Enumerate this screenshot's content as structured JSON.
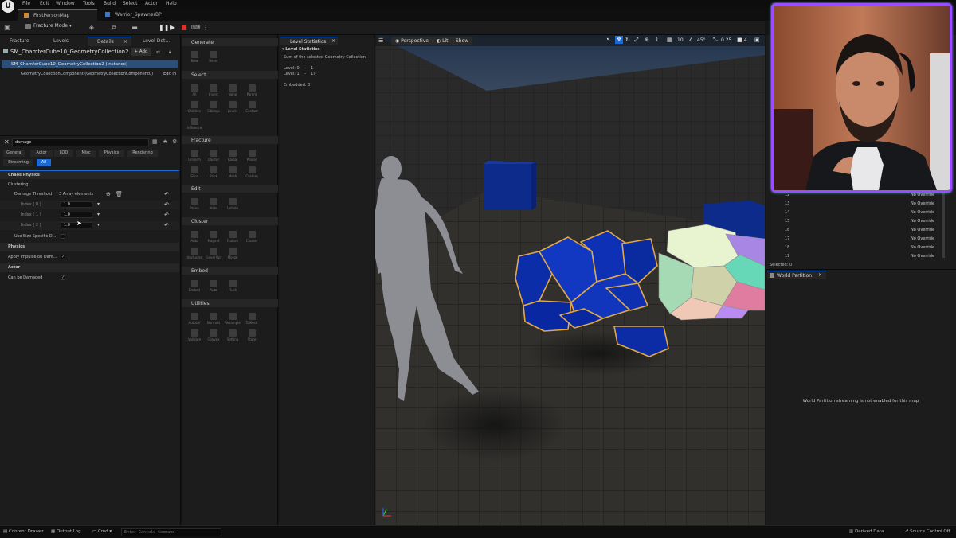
{
  "menubar": {
    "items": [
      "File",
      "Edit",
      "Window",
      "Tools",
      "Build",
      "Select",
      "Actor",
      "Help"
    ]
  },
  "tabs": {
    "map": "FirstPersonMap",
    "blueprint": "Warrior_SpawnerBP"
  },
  "toolbar": {
    "mode": "Fracture Mode"
  },
  "left_panel": {
    "tabs": [
      "Fracture",
      "Levels",
      "Details",
      "Level Det..."
    ],
    "actor_name": "SM_ChamferCube10_GeometryCollection2",
    "add_label": "+ Add",
    "tree": [
      "SM_ChamferCube10_GeometryCollection2 (Instance)",
      "GeometryCollectionComponent (GeometryCollectionComponent0)"
    ],
    "edit_link": "Edit in",
    "search_value": "damage",
    "filters_row1": [
      "General",
      "Actor",
      "LOD",
      "Misc",
      "Physics",
      "Rendering"
    ],
    "filters_row2": [
      "Streaming",
      "All"
    ],
    "sections": {
      "chaos_physics": "Chaos Physics",
      "clustering": "Clustering",
      "damage_threshold": "Damage Threshold",
      "array_count": "3 Array elements",
      "index0": "Index [ 0 ]",
      "index1": "Index [ 1 ]",
      "index2": "Index [ 2 ]",
      "value0": "1.0",
      "value1": "1.0",
      "value2": "1.0",
      "use_size": "Use Size Specific D...",
      "physics": "Physics",
      "apply_impulse": "Apply Impulse on Dam...",
      "actor": "Actor",
      "can_be_damaged": "Can be Damaged"
    }
  },
  "tools_panel": {
    "sections": [
      "Generate",
      "Select",
      "Fracture",
      "Edit",
      "Cluster",
      "Embed",
      "Utilities"
    ],
    "generate": [
      "New",
      "Reset"
    ],
    "select": [
      "All",
      "Invert",
      "None",
      "Parent",
      "Children",
      "Siblings",
      "Levels",
      "Contact",
      "Influence"
    ],
    "fracture": [
      "Uniform",
      "Cluster",
      "Radial",
      "Planar",
      "Slice",
      "Brick",
      "Mesh",
      "Custom"
    ],
    "edit": [
      "Prune",
      "Hide",
      "Unhide"
    ],
    "cluster": [
      "Auto",
      "Magnet",
      "Flatten",
      "Cluster",
      "Uncluster",
      "Level Up",
      "Merge"
    ],
    "embed": [
      "Embed",
      "Auto",
      "Flush"
    ],
    "utilities": [
      "AutoUV",
      "Normals",
      "Resample",
      "ToMesh",
      "Validate",
      "Convex",
      "Setting",
      "State"
    ]
  },
  "stats_panel": {
    "tab": "Level Statistics",
    "header": "Level Statistics",
    "description": "Sum of the selected Geometry Collection",
    "level0": "Level: 0    -    1",
    "level1": "Level: 1    -    19",
    "embedded": "Embedded: 0"
  },
  "viewport": {
    "perspective": "Perspective",
    "lit": "Lit",
    "show": "Show",
    "grid_size": "10",
    "angle": "45°",
    "scale": "0.25",
    "camera_speed": "4"
  },
  "right_panel": {
    "override_rows": [
      {
        "index": "12",
        "value": "No Override"
      },
      {
        "index": "13",
        "value": "No Override"
      },
      {
        "index": "14",
        "value": "No Override"
      },
      {
        "index": "15",
        "value": "No Override"
      },
      {
        "index": "16",
        "value": "No Override"
      },
      {
        "index": "17",
        "value": "No Override"
      },
      {
        "index": "18",
        "value": "No Override"
      },
      {
        "index": "19",
        "value": "No Override"
      }
    ],
    "selected": "Selected: 0",
    "world_partition_tab": "World Partition",
    "world_partition_msg": "World Partition streaming is not enabled for this map"
  },
  "statusbar": {
    "content_drawer": "Content Drawer",
    "output_log": "Output Log",
    "cmd": "Cmd",
    "console_placeholder": "Enter Console Command",
    "derived_data": "Derived Data",
    "source_control": "Source Control Off"
  },
  "colors": {
    "accent": "#1a6bd8",
    "selection": "#2d4f77",
    "webcam_border": "#9a4cff"
  }
}
